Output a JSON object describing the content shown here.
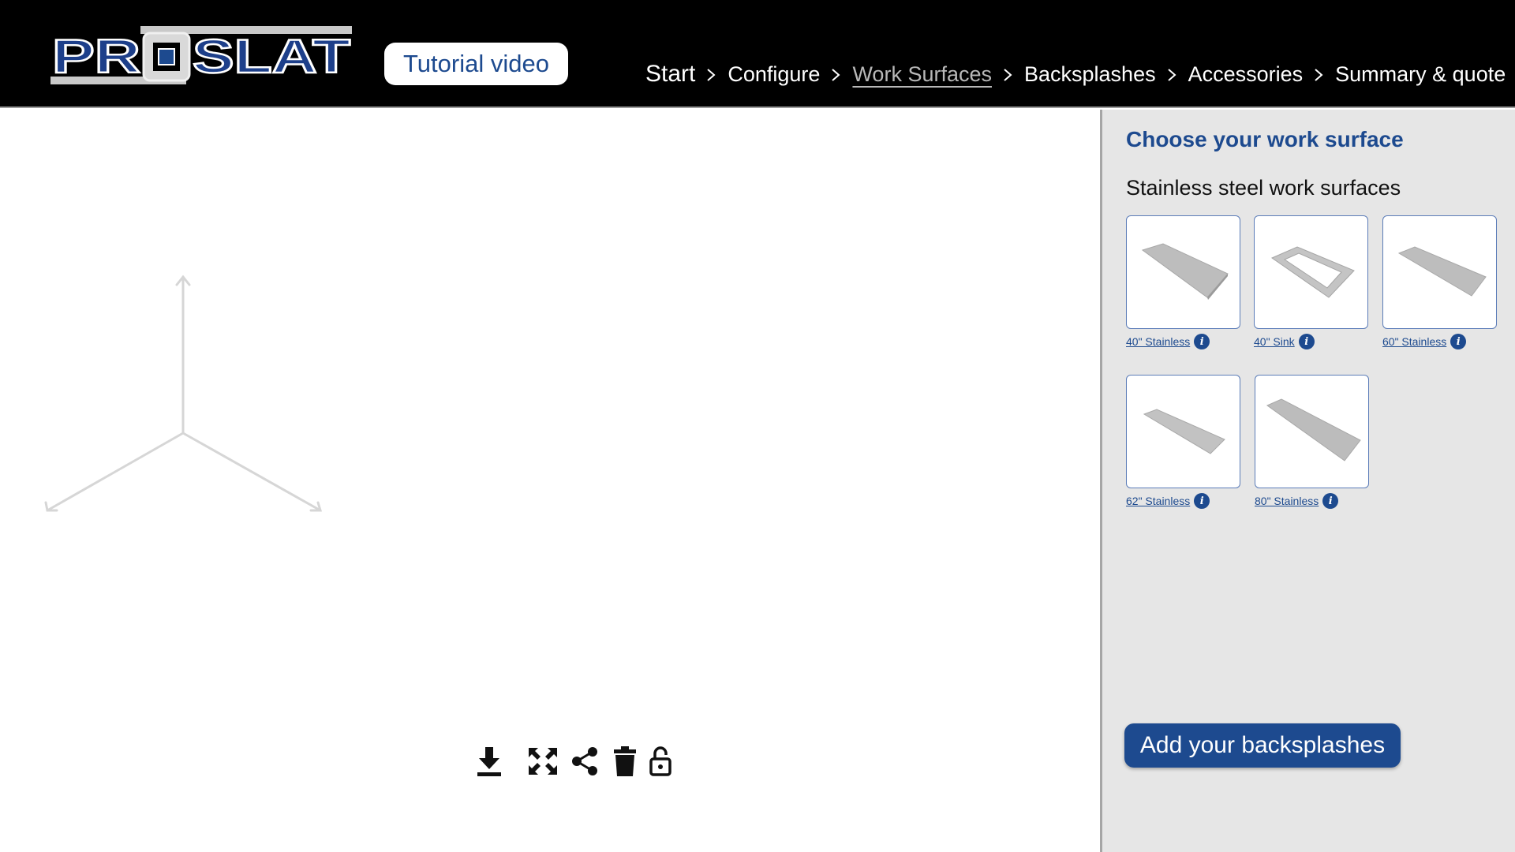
{
  "header": {
    "logo_text": "PROSLAT",
    "tutorial_label": "Tutorial video",
    "steps": [
      {
        "label": "Start",
        "active": false
      },
      {
        "label": "Configure",
        "active": false
      },
      {
        "label": "Work Surfaces",
        "active": true
      },
      {
        "label": "Backsplashes",
        "active": false
      },
      {
        "label": "Accessories",
        "active": false
      },
      {
        "label": "Summary & quote",
        "active": false
      }
    ]
  },
  "toolbar": {
    "icons": [
      "download-icon",
      "fullscreen-icon",
      "share-icon",
      "trash-icon",
      "lock-open-icon"
    ]
  },
  "panel": {
    "title": "Choose your work surface",
    "section_title": "Stainless steel work surfaces",
    "items": [
      {
        "label": "40\" Stainless",
        "type": "slab"
      },
      {
        "label": "40\" Sink",
        "type": "sink"
      },
      {
        "label": "60\" Stainless",
        "type": "slab"
      },
      {
        "label": "62\" Stainless",
        "type": "slab"
      },
      {
        "label": "80\" Stainless",
        "type": "slab"
      }
    ],
    "next_button": "Add your backsplashes"
  },
  "colors": {
    "brand_blue": "#1d4a8f",
    "header_bg": "#000000",
    "panel_bg": "#e6e6e6"
  }
}
